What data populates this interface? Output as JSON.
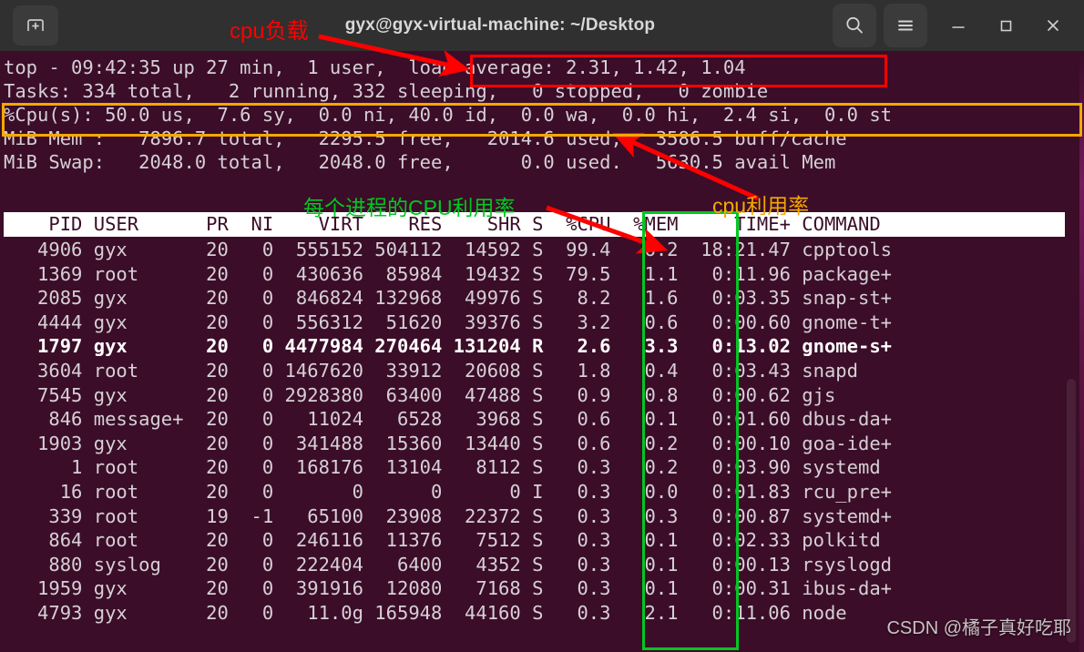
{
  "window": {
    "title": "gyx@gyx-virtual-machine: ~/Desktop",
    "new_tab_icon": "new-tab-icon",
    "search_icon": "search-icon",
    "menu_icon": "hamburger-menu-icon",
    "minimize_icon": "minimize-icon",
    "maximize_icon": "maximize-icon",
    "close_icon": "close-icon"
  },
  "colors": {
    "terminal_bg": "#3b0d28",
    "titlebar_bg": "#303030",
    "text": "#d6d0d6",
    "header_bg": "#ffffff",
    "header_text": "#3b0d28",
    "annotation_red": "#ff0000",
    "annotation_orange": "#f5a800",
    "annotation_green": "#00c820",
    "annotation_yellow": "#f5d000"
  },
  "top_summary": {
    "line1": "top - 09:42:35 up 27 min,  1 user,  load average: 2.31, 1.42, 1.04",
    "line2": "Tasks: 334 total,   2 running, 332 sleeping,   0 stopped,   0 zombie",
    "line3": "%Cpu(s): 50.0 us,  7.6 sy,  0.0 ni, 40.0 id,  0.0 wa,  0.0 hi,  2.4 si,  0.0 st",
    "line4": "MiB Mem :   7896.7 total,   2295.5 free,   2014.6 used,   3586.5 buff/cache",
    "line5": "MiB Swap:   2048.0 total,   2048.0 free,      0.0 used.   5630.5 avail Mem",
    "uptime_clock": "09:42:35",
    "uptime": "27 min",
    "users": "1 user",
    "load_average": "2.31, 1.42, 1.04",
    "tasks_total": "334",
    "tasks_running": "2",
    "tasks_sleeping": "332",
    "tasks_stopped": "0",
    "tasks_zombie": "0",
    "cpu_us": "50.0",
    "cpu_sy": "7.6",
    "cpu_ni": "0.0",
    "cpu_id": "40.0",
    "cpu_wa": "0.0",
    "cpu_hi": "0.0",
    "cpu_si": "2.4",
    "cpu_st": "0.0",
    "mem_total": "7896.7",
    "mem_free": "2295.5",
    "mem_used": "2014.6",
    "mem_buff_cache": "3586.5",
    "swap_total": "2048.0",
    "swap_free": "2048.0",
    "swap_used": "0.0",
    "swap_avail": "5630.5"
  },
  "table": {
    "header_line": "    PID USER      PR  NI    VIRT    RES    SHR S  %CPU  %MEM     TIME+ COMMAND",
    "columns": [
      "PID",
      "USER",
      "PR",
      "NI",
      "VIRT",
      "RES",
      "SHR",
      "S",
      "%CPU",
      "%MEM",
      "TIME+",
      "COMMAND"
    ],
    "rows": [
      {
        "line": "   4906 gyx       20   0  555152 504112  14592 S  99.4   6.2  18:21.47 cpptools",
        "bold": false
      },
      {
        "line": "   1369 root      20   0  430636  85984  19432 S  79.5   1.1   0:11.96 package+",
        "bold": false
      },
      {
        "line": "   2085 gyx       20   0  846824 132968  49976 S   8.2   1.6   0:03.35 snap-st+",
        "bold": false
      },
      {
        "line": "   4444 gyx       20   0  556312  51620  39376 S   3.2   0.6   0:00.60 gnome-t+",
        "bold": false
      },
      {
        "line": "   1797 gyx       20   0 4477984 270464 131204 R   2.6   3.3   0:13.02 gnome-s+",
        "bold": true
      },
      {
        "line": "   3604 root      20   0 1467620  33912  20608 S   1.8   0.4   0:03.43 snapd",
        "bold": false
      },
      {
        "line": "   7545 gyx       20   0 2928380  63400  47488 S   0.9   0.8   0:00.62 gjs",
        "bold": false
      },
      {
        "line": "    846 message+  20   0   11024   6528   3968 S   0.6   0.1   0:01.60 dbus-da+",
        "bold": false
      },
      {
        "line": "   1903 gyx       20   0  341488  15360  13440 S   0.6   0.2   0:00.10 goa-ide+",
        "bold": false
      },
      {
        "line": "      1 root      20   0  168176  13104   8112 S   0.3   0.2   0:03.90 systemd",
        "bold": false
      },
      {
        "line": "     16 root      20   0       0      0      0 I   0.3   0.0   0:01.83 rcu_pre+",
        "bold": false
      },
      {
        "line": "    339 root      19  -1   65100  23908  22372 S   0.3   0.3   0:00.87 systemd+",
        "bold": false
      },
      {
        "line": "    864 root      20   0  246116  11376   7512 S   0.3   0.1   0:02.33 polkitd",
        "bold": false
      },
      {
        "line": "    880 syslog    20   0  222404   6400   4352 S   0.3   0.1   0:00.13 rsyslogd",
        "bold": false
      },
      {
        "line": "   1959 gyx       20   0  391916  12080   7168 S   0.3   0.1   0:00.31 ibus-da+",
        "bold": false
      },
      {
        "line": "   4793 gyx       20   0   11.0g 165948  44160 S   0.3   2.1   0:11.06 node",
        "bold": false
      }
    ]
  },
  "annotations": [
    {
      "id": "cpu-load-label",
      "text": "cpu负载",
      "color": "#ff0000"
    },
    {
      "id": "cpu-usage-label",
      "text": "cpu利用率",
      "color": "#f5a800"
    },
    {
      "id": "per-process-cpu-label",
      "text": "每个进程的CPU利用率",
      "color": "#00c820"
    }
  ],
  "watermark": {
    "text": "CSDN @橘子真好吃耶"
  }
}
